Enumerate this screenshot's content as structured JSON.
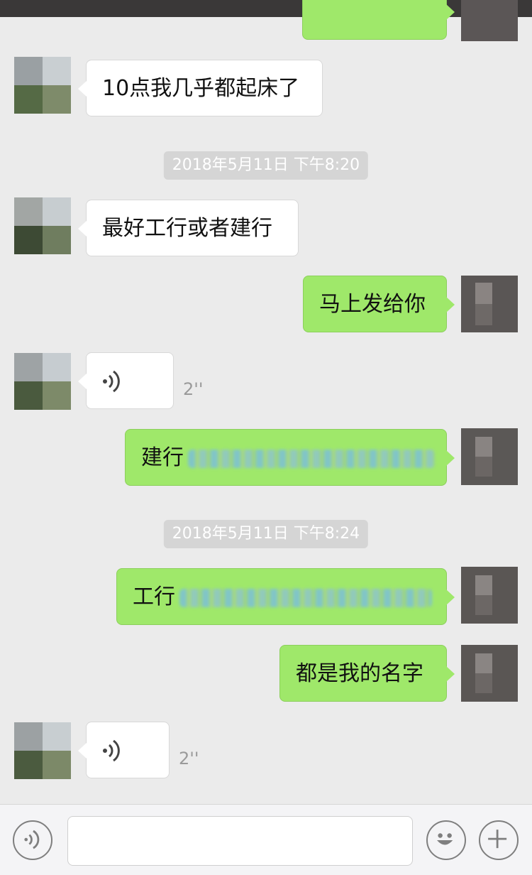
{
  "messages": {
    "m1": {
      "text": "10点我几乎都起床了"
    },
    "ts1": {
      "text": "2018年5月11日 下午8:20"
    },
    "m2": {
      "text": "最好工行或者建行"
    },
    "m3": {
      "text": "马上发给你"
    },
    "m4": {
      "duration": "2''"
    },
    "m5": {
      "text": "建行"
    },
    "ts2": {
      "text": "2018年5月11日 下午8:24"
    },
    "m6": {
      "text": "工行"
    },
    "m7": {
      "text": "都是我的名字"
    },
    "m8": {
      "duration": "2''"
    }
  },
  "input": {
    "placeholder": ""
  },
  "icons": {
    "voice_button": "voice-icon",
    "emoji_button": "emoji-icon",
    "plus_button": "plus-icon"
  },
  "colors": {
    "outgoing_bubble": "#9fe86a",
    "incoming_bubble": "#ffffff",
    "background": "#ebebeb",
    "timestamp_bg": "#d5d5d5"
  }
}
